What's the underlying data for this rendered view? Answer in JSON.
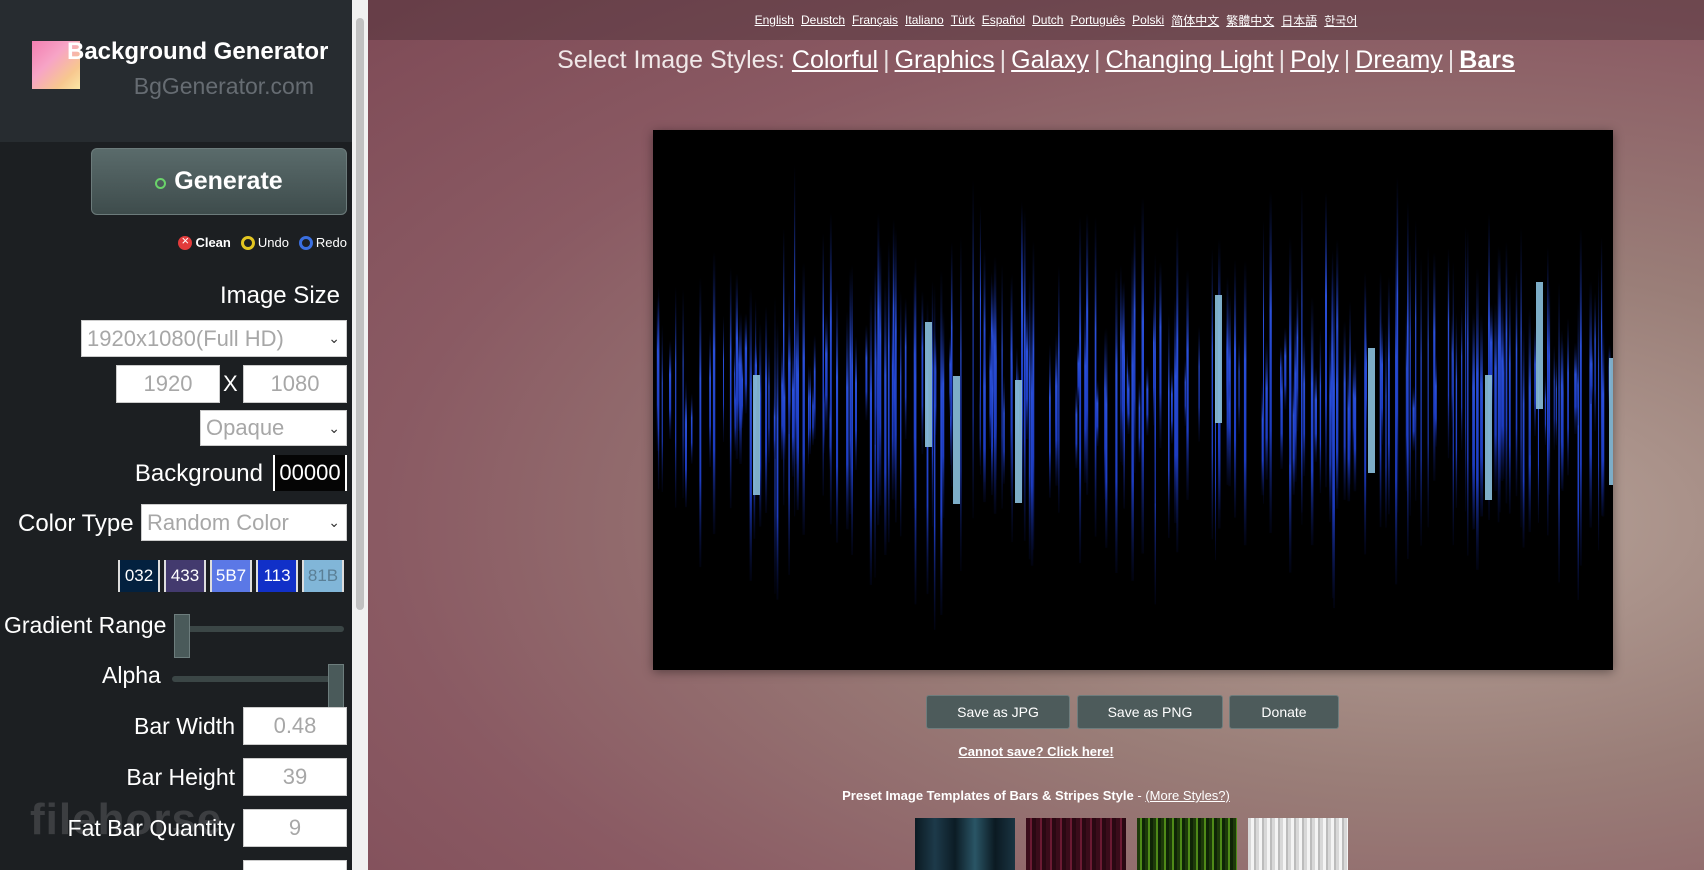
{
  "app": {
    "title": "Background Generator",
    "subtitle": "BgGenerator.com"
  },
  "sidebar": {
    "generate_label": "Generate",
    "actions": {
      "clean": "Clean",
      "undo": "Undo",
      "redo": "Redo"
    },
    "image_size": {
      "label": "Image Size",
      "preset": "1920x1080(Full HD)",
      "width": "1920",
      "x_label": "X",
      "height": "1080",
      "opacity": "Opaque"
    },
    "background": {
      "label": "Background",
      "value": "00000"
    },
    "color_type": {
      "label": "Color Type",
      "value": "Random Color"
    },
    "swatches": [
      {
        "text": "032",
        "color": "#03213f"
      },
      {
        "text": "433",
        "color": "#433a6e"
      },
      {
        "text": "5B7",
        "color": "#5b78e6"
      },
      {
        "text": "113",
        "color": "#1130c8"
      },
      {
        "text": "81B",
        "color": "#81b6d8"
      }
    ],
    "gradient_range": {
      "label": "Gradient Range",
      "level": 0.0
    },
    "alpha": {
      "label": "Alpha",
      "level": 1.0
    },
    "bar_width": {
      "label": "Bar Width",
      "value": "0.48"
    },
    "bar_height": {
      "label": "Bar Height",
      "value": "39"
    },
    "fat_bar_quantity": {
      "label": "Fat Bar Quantity",
      "value": "9"
    },
    "watermark": "filehorse"
  },
  "languages": [
    "English",
    "Deustch",
    "Français",
    "Italiano",
    "Türk",
    "Español",
    "Dutch",
    "Português",
    "Polski",
    "简体中文",
    "繁體中文",
    "日本語",
    "한국어"
  ],
  "styles": {
    "prefix": "Select Image Styles:",
    "items": [
      "Colorful",
      "Graphics",
      "Galaxy",
      "Changing Light",
      "Poly",
      "Dreamy",
      "Bars"
    ],
    "active": "Bars"
  },
  "buttons": {
    "save_jpg": "Save as JPG",
    "save_png": "Save as PNG",
    "donate": "Donate",
    "cannot_save": "Cannot save? Click here!"
  },
  "presets": {
    "title": "Preset Image Templates of Bars & Stripes Style",
    "dash": " - ",
    "more": "(More Styles?)"
  },
  "colors": {
    "canvas_bg": "#000000",
    "accent_green": "#6ad36a"
  }
}
